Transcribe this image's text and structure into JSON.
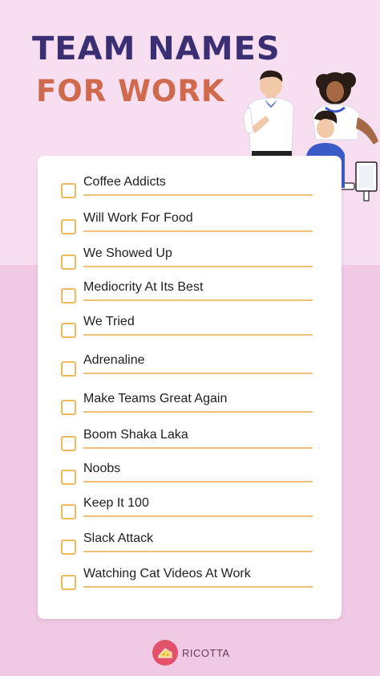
{
  "title": {
    "line1": "TEAM NAMES",
    "line2": "FOR WORK"
  },
  "checklist": [
    "Coffee Addicts",
    "Will Work For Food",
    "We Showed Up",
    "Mediocrity At Its Best",
    "We Tried",
    "Adrenaline",
    "Make Teams Great Again",
    "Boom Shaka Laka",
    "Noobs",
    "Keep It 100",
    "Slack Attack",
    "Watching Cat Videos At Work"
  ],
  "brand": {
    "name": "RICOTTA",
    "logo_icon": "cheese-icon"
  },
  "colors": {
    "title_primary": "#3a2f73",
    "title_accent": "#cf6a4d",
    "checkbox_border": "#f0b95a",
    "brand": "#e3526a"
  }
}
